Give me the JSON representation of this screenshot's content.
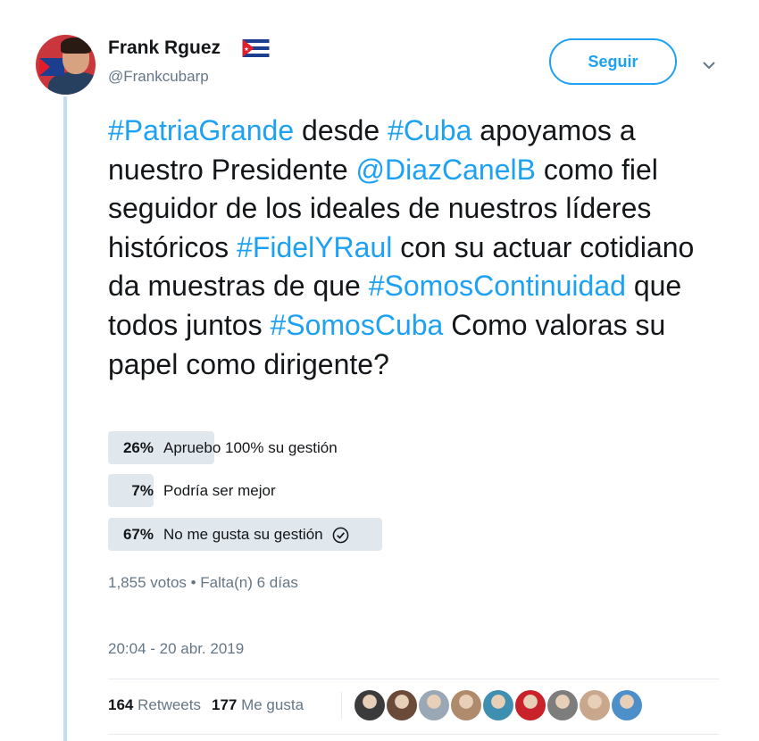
{
  "author": {
    "name": "Frank Rguez",
    "handle": "@Frankcubarp",
    "follow_label": "Seguir"
  },
  "tweet": {
    "segments": [
      {
        "text": "#PatriaGrande",
        "link": true
      },
      {
        "text": " desde ",
        "link": false
      },
      {
        "text": "#Cuba",
        "link": true
      },
      {
        "text": " apoyamos a nuestro Presidente ",
        "link": false
      },
      {
        "text": "@DiazCanelB",
        "link": true
      },
      {
        "text": " como fiel seguidor de los ideales de nuestros líderes históricos ",
        "link": false
      },
      {
        "text": "#FidelYRaul",
        "link": true
      },
      {
        "text": " con su actuar cotidiano da muestras de que ",
        "link": false
      },
      {
        "text": "#SomosContinuidad",
        "link": true
      },
      {
        "text": " que todos juntos ",
        "link": false
      },
      {
        "text": "#SomosCuba",
        "link": true
      },
      {
        "text": "  Como valoras su papel como dirigente?",
        "link": false
      }
    ]
  },
  "poll": {
    "options": [
      {
        "pct_label": "26%",
        "label": "Apruebo 100% su gestión",
        "fraction": 0.26
      },
      {
        "pct_label": "7%",
        "label": "Podría ser mejor",
        "fraction": 0.07
      },
      {
        "pct_label": "67%",
        "label": "No me gusta su gestión",
        "fraction": 0.67,
        "selected": true
      }
    ],
    "meta": "1,855 votos • Falta(n) 6 días"
  },
  "timestamp": "20:04 - 20 abr. 2019",
  "stats": {
    "retweets_count": "164",
    "retweets_label": "Retweets",
    "likes_count": "177",
    "likes_label": "Me gusta"
  },
  "likers": [
    {
      "name": "liker-avatar-1",
      "color": "#3b3b3b"
    },
    {
      "name": "liker-avatar-2",
      "color": "#6b4a3a"
    },
    {
      "name": "liker-avatar-3",
      "color": "#9aa7b5"
    },
    {
      "name": "liker-avatar-4",
      "color": "#b08a6c"
    },
    {
      "name": "liker-avatar-5",
      "color": "#3f8fb0"
    },
    {
      "name": "liker-avatar-6",
      "color": "#c8222b"
    },
    {
      "name": "liker-avatar-7",
      "color": "#7d7d7d"
    },
    {
      "name": "liker-avatar-8",
      "color": "#c9a78d"
    },
    {
      "name": "liker-avatar-9",
      "color": "#4d8fc9"
    }
  ],
  "colors": {
    "link": "#1da1f2",
    "thread_line": "#c4ddf0",
    "poll_bar": "#e1e8ed",
    "secondary_text": "#657786"
  }
}
